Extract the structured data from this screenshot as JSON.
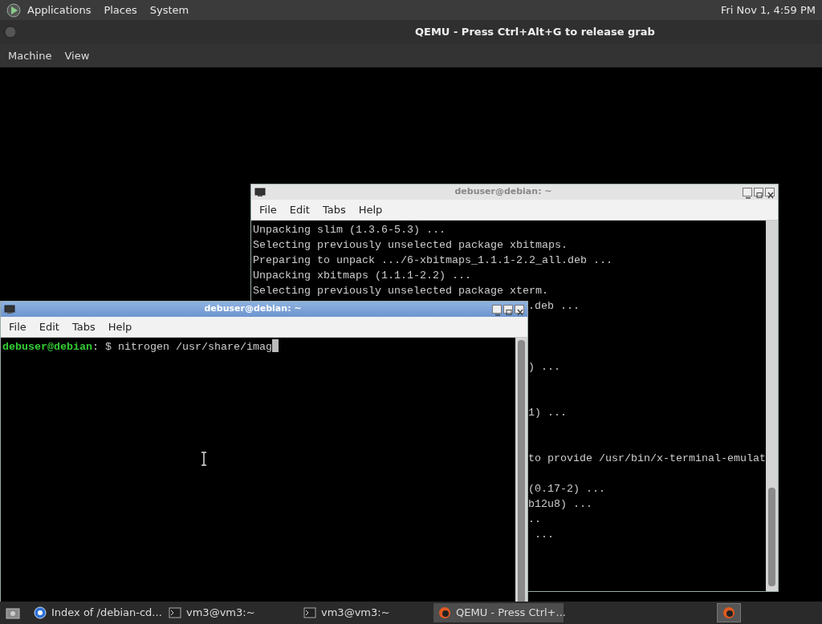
{
  "top_panel": {
    "menus": [
      "Applications",
      "Places",
      "System"
    ],
    "clock": "Fri Nov 1, 4:59 PM"
  },
  "qemu": {
    "title": "QEMU - Press Ctrl+Alt+G to release grab",
    "menus": [
      "Machine",
      "View"
    ]
  },
  "terminals": [
    {
      "title": "debuser@debian: ~",
      "active": false,
      "menus": [
        "File",
        "Edit",
        "Tabs",
        "Help"
      ],
      "lines": [
        {
          "text": "Unpacking slim (1.3.6-5.3) ...",
          "clipped": false
        },
        {
          "text": "Selecting previously unselected package xbitmaps.",
          "clipped": false
        },
        {
          "text": "Preparing to unpack .../6-xbitmaps_1.1.1-2.2_all.deb ...",
          "clipped": false
        },
        {
          "text": "Unpacking xbitmaps (1.1.1-2.2) ...",
          "clipped": false
        },
        {
          "text": "Selecting previously unselected package xterm.",
          "clipped": false
        },
        {
          "text": ".deb ...",
          "clipped": true
        },
        {
          "text": ") ...",
          "clipped": true
        },
        {
          "text": "1) ...",
          "clipped": true
        },
        {
          "text": "to provide /usr/bin/x-terminal-emulat",
          "clipped": true
        },
        {
          "text": "(0.17-2) ...",
          "clipped": true
        },
        {
          "text": "b12u8) ...",
          "clipped": true
        },
        {
          "text": "..",
          "clipped": true
        },
        {
          "text": " ...",
          "clipped": true
        }
      ]
    },
    {
      "title": "debuser@debian: ~",
      "active": true,
      "menus": [
        "File",
        "Edit",
        "Tabs",
        "Help"
      ],
      "prompt": {
        "user": "debuser@debian",
        "command": ": $ nitrogen /usr/share/imag"
      }
    }
  ],
  "taskbar": [
    {
      "label": "Index of /debian-cd...",
      "kind": "browser",
      "selected": false
    },
    {
      "label": "vm3@vm3:~",
      "kind": "terminal",
      "selected": false
    },
    {
      "label": "vm3@vm3:~",
      "kind": "terminal",
      "selected": false
    },
    {
      "label": "QEMU - Press Ctrl+...",
      "kind": "qemu",
      "selected": true
    }
  ]
}
